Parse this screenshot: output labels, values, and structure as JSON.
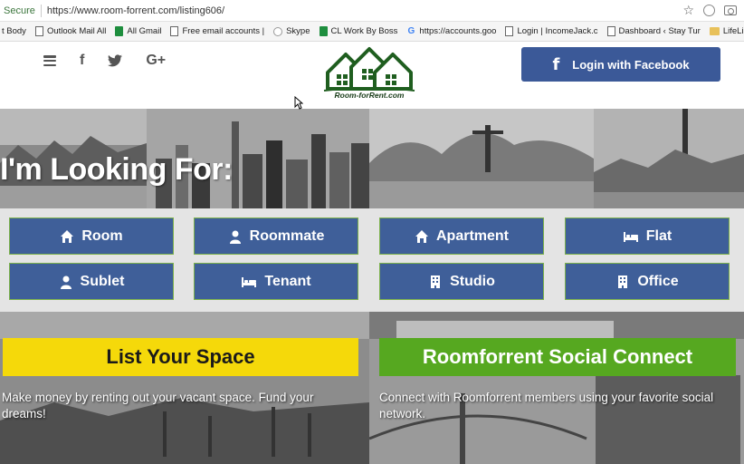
{
  "browser": {
    "secure_label": "Secure",
    "url": "https://www.room-forrent.com/listing606/",
    "bookmarks": [
      {
        "label": "t Body",
        "icon": "doc-icon"
      },
      {
        "label": "Outlook Mail All",
        "icon": "doc-icon"
      },
      {
        "label": "All Gmail",
        "icon": "sheet-icon"
      },
      {
        "label": "Free email accounts |",
        "icon": "doc-icon"
      },
      {
        "label": "Skype",
        "icon": "skype-icon"
      },
      {
        "label": "CL Work By Boss",
        "icon": "sheet-icon"
      },
      {
        "label": "https://accounts.goo",
        "icon": "google-icon"
      },
      {
        "label": "Login | IncomeJack.c",
        "icon": "doc-icon"
      },
      {
        "label": "Dashboard ‹ Stay Tur",
        "icon": "doc-icon"
      },
      {
        "label": "LifeLine",
        "icon": "folder-icon"
      }
    ]
  },
  "header": {
    "logo_text": "Room-forRent.com",
    "login_label": "Login with Facebook",
    "social_icons": [
      "menu-icon",
      "facebook-icon",
      "twitter-icon",
      "google-plus-icon"
    ]
  },
  "hero": {
    "title": "I'm Looking For:"
  },
  "categories": [
    {
      "label": "Room",
      "icon": "home-icon"
    },
    {
      "label": "Roommate",
      "icon": "user-icon"
    },
    {
      "label": "Apartment",
      "icon": "home-icon"
    },
    {
      "label": "Flat",
      "icon": "bed-icon"
    },
    {
      "label": "Sublet",
      "icon": "user-icon"
    },
    {
      "label": "Tenant",
      "icon": "bed-icon"
    },
    {
      "label": "Studio",
      "icon": "building-icon"
    },
    {
      "label": "Office",
      "icon": "building-icon"
    }
  ],
  "cta": {
    "list_label": "List Your Space",
    "list_desc": "Make money by renting out your vacant space. Fund your dreams!",
    "social_label": "Roomforrent Social Connect",
    "social_desc": "Connect with Roomforrent members using your favorite social network."
  },
  "colors": {
    "facebook_blue": "#3b5998",
    "category_blue": "#3f5f99",
    "list_yellow": "#f5d90a",
    "social_green": "#56a820"
  }
}
